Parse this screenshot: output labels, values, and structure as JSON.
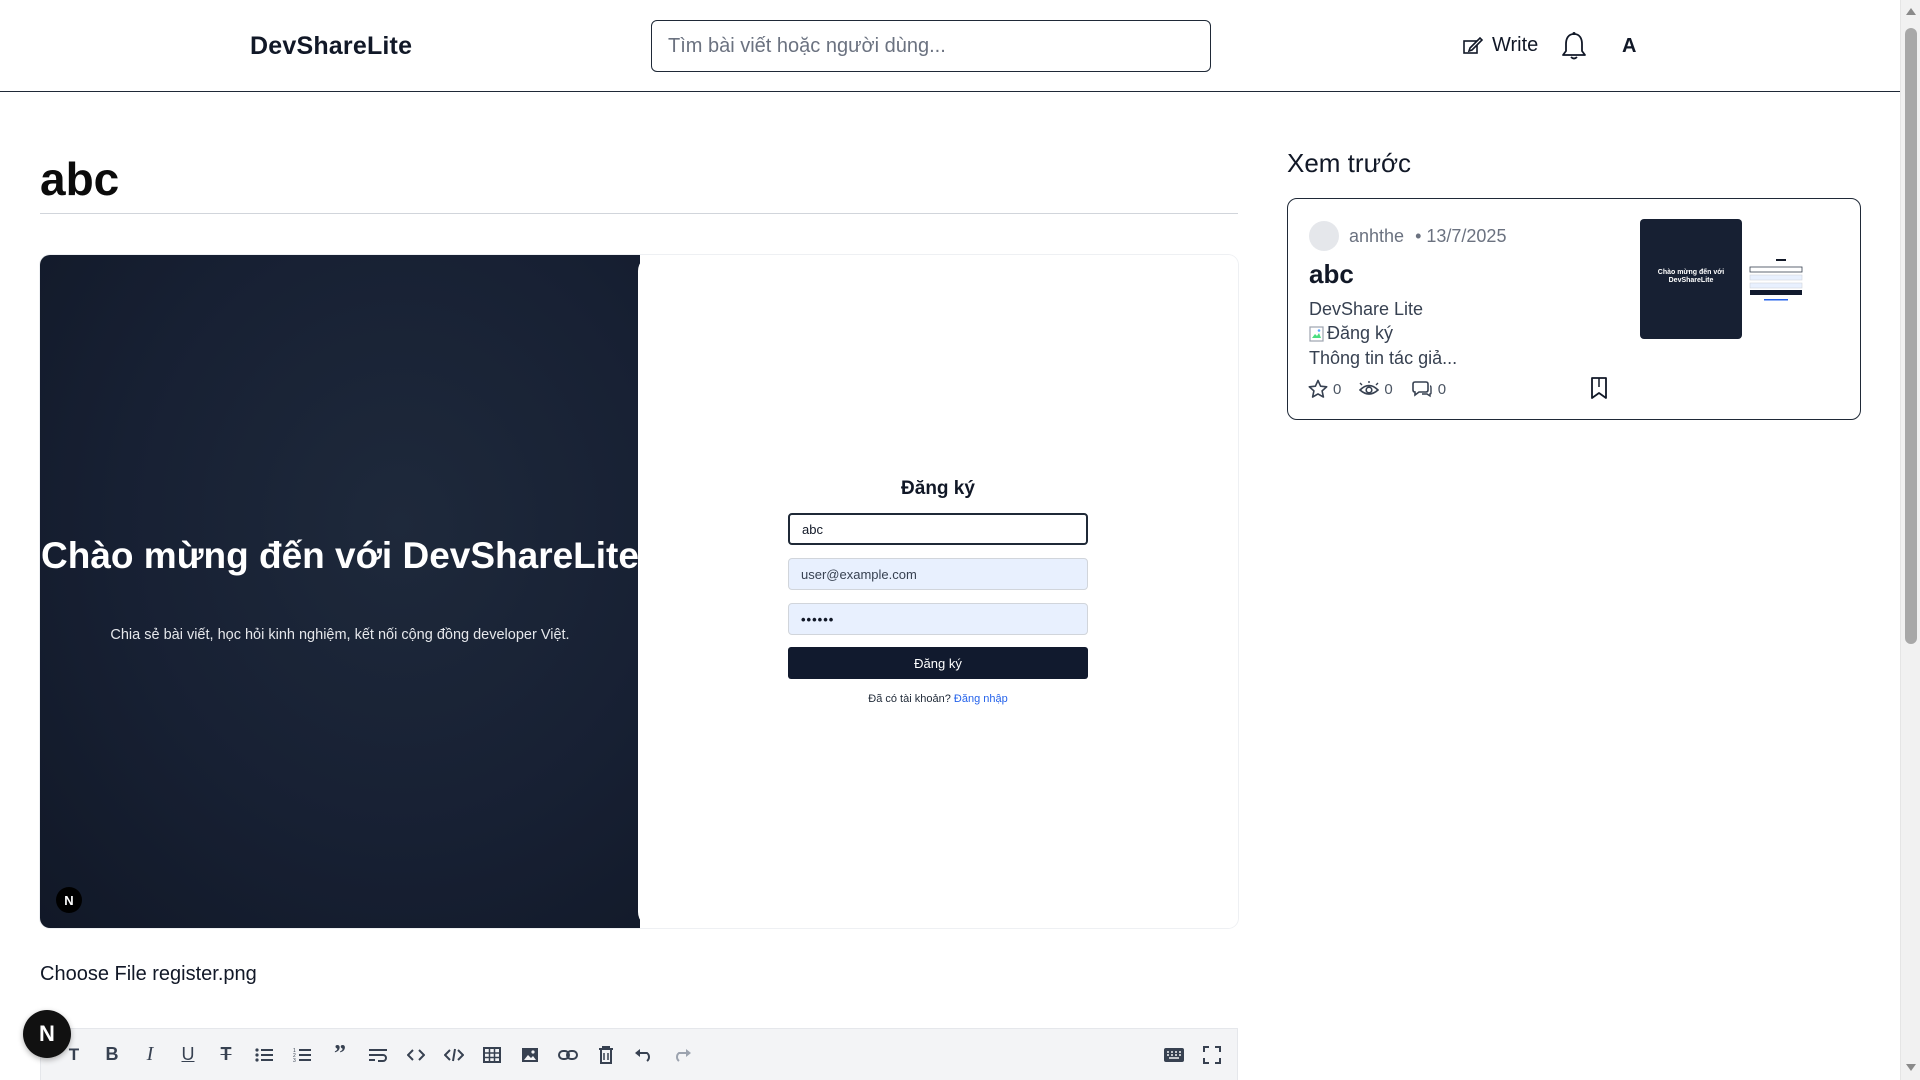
{
  "header": {
    "logo": "DevShareLite",
    "search_placeholder": "Tìm bài viết hoặc người dùng...",
    "write_label": "Write",
    "avatar_letter": "A"
  },
  "editor": {
    "title": "abc",
    "file_input": "Choose File register.png",
    "image": {
      "welcome_title": "Chào mừng đến với DevShareLite",
      "welcome_sub": "Chia sẻ bài viết, học hỏi kinh nghiệm, kết nối cộng đồng developer Việt.",
      "badge": "N",
      "register_title": "Đăng ký",
      "name_value": "abc",
      "email_value": "user@example.com",
      "password_value": "••••••",
      "submit_label": "Đăng ký",
      "footer_text": "Đã có tài khoản?",
      "footer_link": "Đăng nhập"
    },
    "toolbar": [
      "heading-icon",
      "bold-icon",
      "italic-icon",
      "underline-icon",
      "strikethrough-icon",
      "bullet-list-icon",
      "ordered-list-icon",
      "quote-icon",
      "wrap-icon",
      "code-icon",
      "code-block-icon",
      "table-icon",
      "image-icon",
      "link-icon",
      "delete-icon",
      "undo-icon",
      "redo-icon",
      "keyboard-icon",
      "fullscreen-icon"
    ]
  },
  "preview": {
    "heading": "Xem trước",
    "author": "anhthe",
    "date": "• 13/7/2025",
    "title": "abc",
    "line1": "DevShare Lite",
    "line2": "Đăng ký",
    "line3": "Thông tin tác giả...",
    "likes": "0",
    "views": "0",
    "comments": "0",
    "thumb_text": "Chào mừng đến với DevShareLite"
  },
  "floating_badge": "N",
  "colors": {
    "dark_panel": "#172033",
    "link": "#2563eb",
    "autofill": "#e8f0fe"
  }
}
